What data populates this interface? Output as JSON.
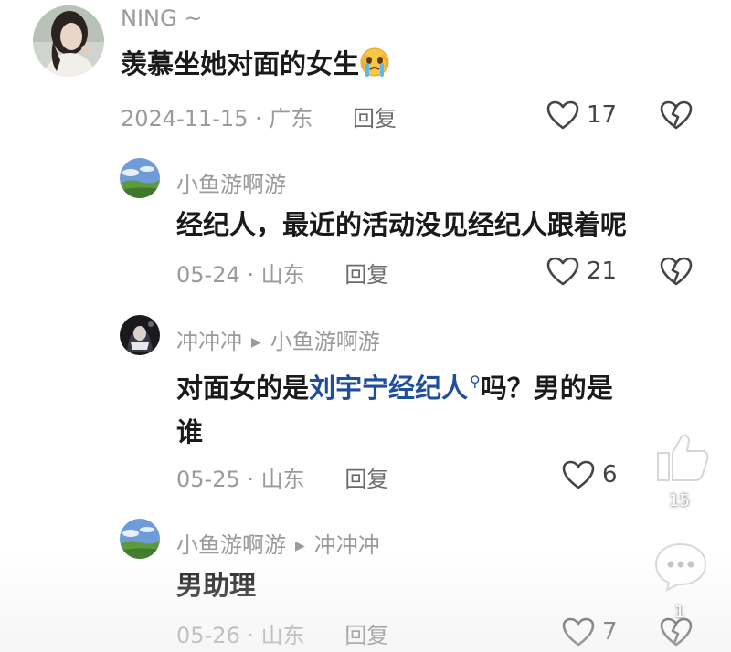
{
  "comments": [
    {
      "user": "NING ~",
      "text": "羡慕坐她对面的女生",
      "emoji": "crying-face-emoji",
      "date": "2024-11-15",
      "location": "广东",
      "reply_label": "回复",
      "likes": "17"
    },
    {
      "user": "小鱼游啊游",
      "text": "经纪人，最近的活动没见经纪人跟着呢",
      "date": "05-24",
      "location": "山东",
      "reply_label": "回复",
      "likes": "21"
    },
    {
      "user": "冲冲冲",
      "reply_to": "小鱼游啊游",
      "text_before": "对面女的是",
      "link_text": "刘宇宁经纪人",
      "text_after": "吗？男的是",
      "text_line2": "谁",
      "date": "05-25",
      "location": "山东",
      "reply_label": "回复",
      "likes": "6"
    },
    {
      "user": "小鱼游啊游",
      "reply_to": "冲冲冲",
      "text": "男助理",
      "date": "05-26",
      "location": "山东",
      "reply_label": "回复",
      "likes": "7"
    }
  ],
  "meta_separator": "·",
  "overlay": {
    "like_count": "15",
    "comment_count": "1"
  },
  "colors": {
    "username": "#9a9a9a",
    "body_text": "#1a1a1a",
    "link": "#1f4e9c",
    "meta": "#9a9a9a"
  }
}
